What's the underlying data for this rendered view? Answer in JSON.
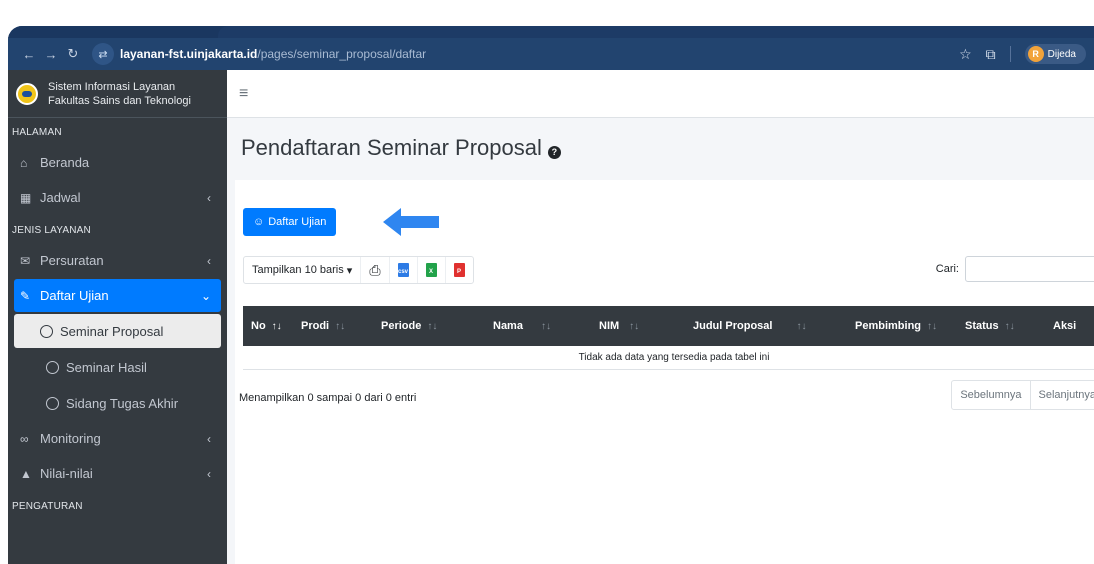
{
  "browser": {
    "url_host": "layanan-fst.uinjakarta.id",
    "url_path": "/pages/seminar_proposal/daftar",
    "profile_initial": "R",
    "profile_name": "Dijeda"
  },
  "sidebar": {
    "brand_line1": "Sistem Informasi Layanan",
    "brand_line2": "Fakultas Sains dan Teknologi",
    "header_halaman": "HALAMAN",
    "beranda": "Beranda",
    "jadwal": "Jadwal",
    "header_layanan": "JENIS LAYANAN",
    "persuratan": "Persuratan",
    "daftar_ujian": "Daftar Ujian",
    "sub_items": [
      "Seminar Proposal",
      "Seminar Hasil",
      "Sidang Tugas Akhir"
    ],
    "monitoring": "Monitoring",
    "nilai": "Nilai-nilai",
    "header_pengaturan": "PENGATURAN"
  },
  "page": {
    "title": "Pendaftaran Seminar Proposal",
    "primary_button": "Daftar Ujian",
    "length_menu": "Tampilkan 10 baris",
    "search_label": "Cari:",
    "search_value": "",
    "columns": [
      "No",
      "Prodi",
      "Periode",
      "Nama",
      "NIM",
      "Judul Proposal",
      "Pembimbing",
      "Status",
      "Aksi"
    ],
    "empty_message": "Tidak ada data yang tersedia pada tabel ini",
    "info": "Menampilkan 0 sampai 0 dari 0 entri",
    "prev": "Sebelumnya",
    "next": "Selanjutnya"
  },
  "colors": {
    "primary": "#007bff",
    "sidebar": "#343a40",
    "arrow": "#2f86f0"
  }
}
